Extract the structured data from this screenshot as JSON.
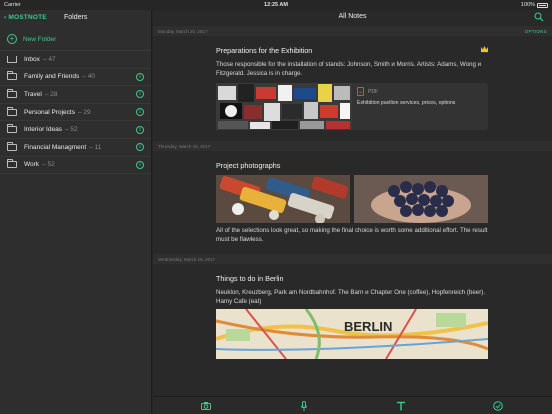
{
  "status": {
    "carrier": "Carrier",
    "time": "12:25 AM",
    "battery": "100%"
  },
  "sidebar": {
    "back_label": "MOSTNOTE",
    "title": "Folders",
    "new_folder": "New Folder",
    "inbox": {
      "label": "Inbox",
      "count": "– 47"
    },
    "folders": [
      {
        "label": "Family and Friends",
        "count": "– 40"
      },
      {
        "label": "Travel",
        "count": "– 28"
      },
      {
        "label": "Personal Projects",
        "count": "– 29"
      },
      {
        "label": "Interior Ideas",
        "count": "– 52"
      },
      {
        "label": "Financial Managment",
        "count": "– 11"
      },
      {
        "label": "Work",
        "count": "– 52"
      }
    ]
  },
  "main": {
    "title": "All Notes",
    "options_label": "OPTIONS",
    "days": [
      "Monday, March 20, 2017",
      "Thursday, March 16, 2017",
      "Wednesday, March 15, 2017"
    ],
    "notes": [
      {
        "title": "Preparations for the Exhibition",
        "text": "Those responsible for the installation of stands: Johnson, Smith и Morris. Artists: Adams, Wong и Fitzgerald. Jessica is in charge.",
        "attachment_type": "PDF",
        "attachment_desc": "Exhibition pavilion services, prices, options"
      },
      {
        "title": "Project photographs",
        "text": "All of the selections look great, so making the final choice is worth some additional effort. The result must be flawless."
      },
      {
        "title": "Things to do in Berlin",
        "text": "Neuklon, Kreuzberg, Park am Nordbahnhof. The Barn и Chapter One (coffee), Hopfenreich (beer). Hamy Cafe (eat)",
        "map_label": "BERLIN"
      }
    ]
  },
  "colors": {
    "accent": "#3fc98a",
    "bookmark": "#f0c419",
    "pdf": "#e04a3a"
  }
}
